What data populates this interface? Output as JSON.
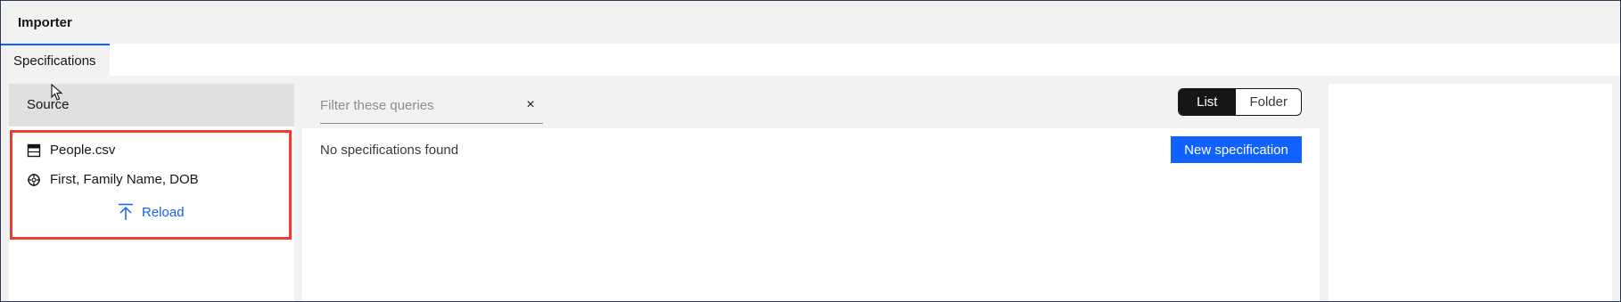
{
  "app": {
    "title": "Importer"
  },
  "tabs": [
    {
      "label": "Specifications",
      "active": true
    }
  ],
  "source": {
    "header": "Source",
    "file_name": "People.csv",
    "fields": "First, Family Name, DOB",
    "reload_label": "Reload",
    "icons": {
      "file": "table-file-icon",
      "fields": "crosshair-target-icon",
      "reload": "upload-arrow-icon"
    }
  },
  "specifications": {
    "filter_placeholder": "Filter these queries",
    "filter_value": "",
    "view_toggle": {
      "list": "List",
      "folder": "Folder",
      "selected": "List"
    },
    "empty_message": "No specifications found",
    "new_button": "New specification"
  },
  "colors": {
    "accent": "#0f62fe",
    "highlight_border": "#f13a2d",
    "toggle_active_bg": "#161616"
  }
}
